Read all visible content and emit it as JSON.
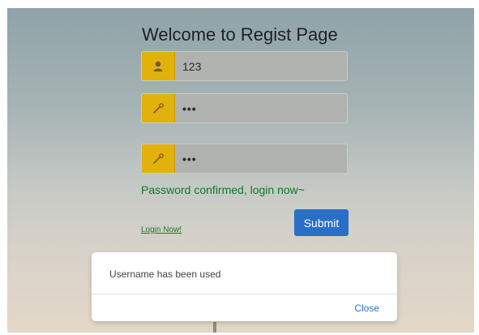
{
  "page": {
    "title": "Welcome to Regist Page"
  },
  "form": {
    "username": {
      "value": "123",
      "icon": "user-icon"
    },
    "password": {
      "value": "•••",
      "icon": "key-icon"
    },
    "confirm_password": {
      "value": "•••",
      "icon": "key-icon"
    },
    "status_message": "Password confirmed, login now~",
    "login_link": "Login Now!",
    "submit_label": "Submit"
  },
  "modal": {
    "message": "Username has been used",
    "close_label": "Close"
  },
  "colors": {
    "addon": "#e3b10c",
    "primary": "#2a6fc6",
    "success": "#0f7a22"
  }
}
